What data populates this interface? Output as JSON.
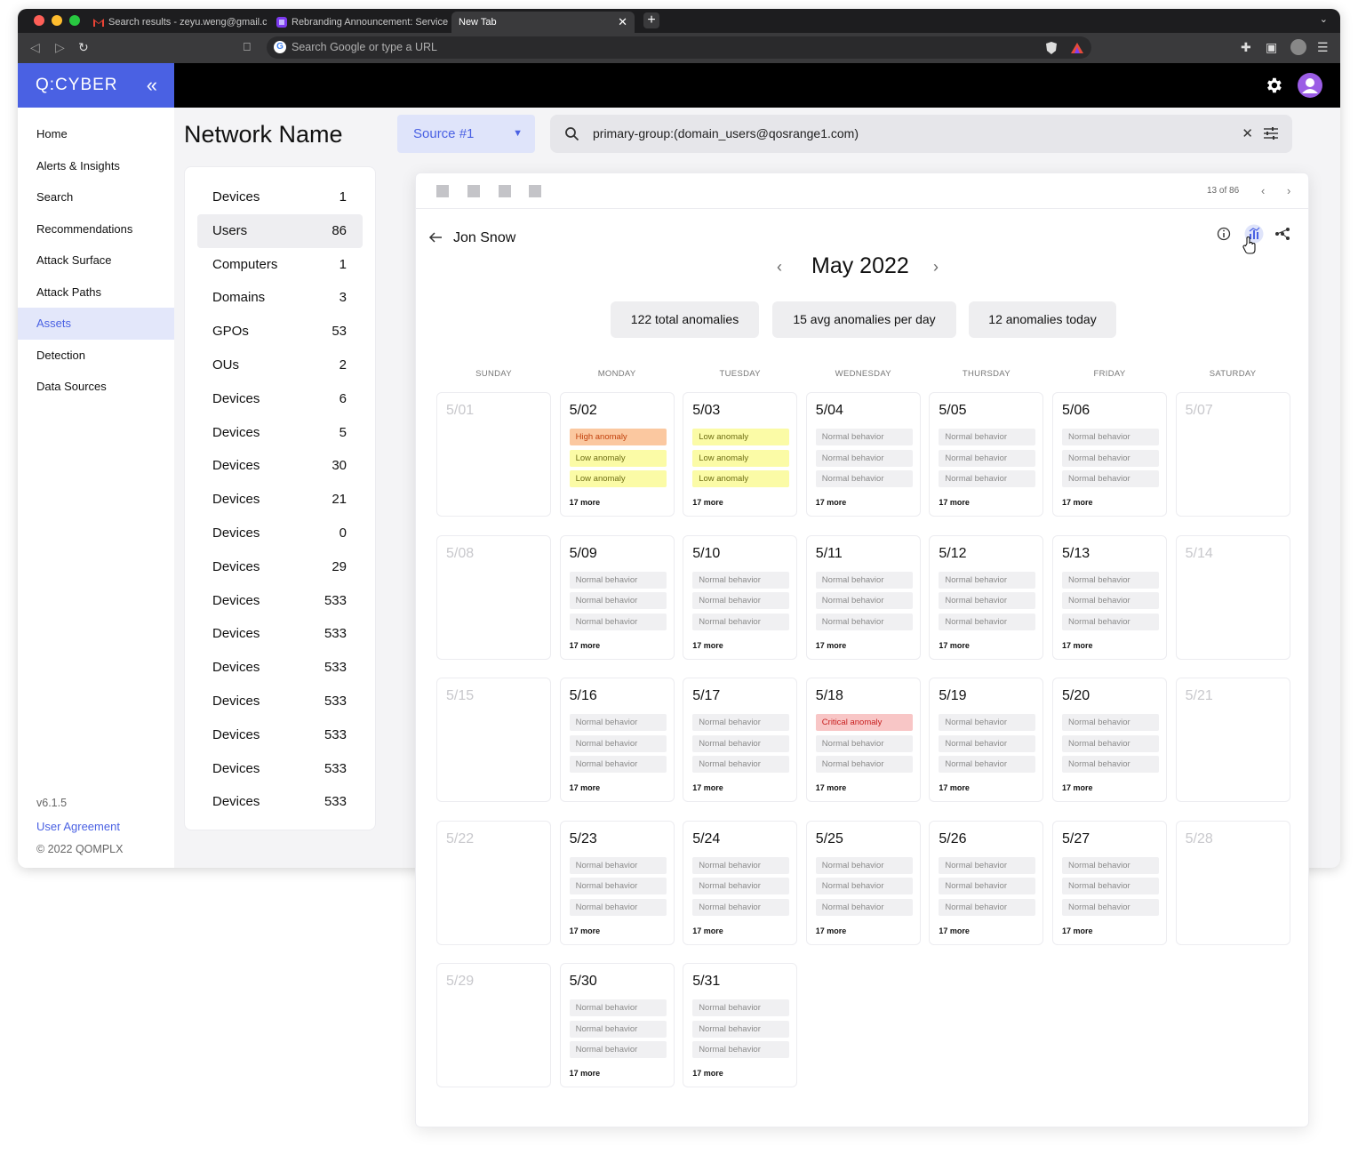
{
  "browser": {
    "tabs": [
      {
        "label": "Search results - zeyu.weng@gmail.c",
        "icon": "gmail-icon"
      },
      {
        "label": "Rebranding Announcement: Service",
        "icon": "slack-icon"
      },
      {
        "label": "New Tab",
        "active": true
      }
    ],
    "omnibox_placeholder": "Search Google or type a URL"
  },
  "app": {
    "brand": "Q:CYBER",
    "collapse_icon": "«"
  },
  "sidebar": {
    "items": [
      "Home",
      "Alerts & Insights",
      "Search",
      "Recommendations",
      "Attack Surface",
      "Attack Paths",
      "Assets",
      "Detection",
      "Data Sources"
    ],
    "active_index": 6,
    "version": "v6.1.5",
    "agreement": "User Agreement",
    "copyright": "© 2022 QOMPLX"
  },
  "network": {
    "title": "Network Name",
    "rows": [
      {
        "label": "Devices",
        "count": "1"
      },
      {
        "label": "Users",
        "count": "86",
        "selected": true
      },
      {
        "label": "Computers",
        "count": "1"
      },
      {
        "label": "Domains",
        "count": "3"
      },
      {
        "label": "GPOs",
        "count": "53"
      },
      {
        "label": "OUs",
        "count": "2"
      },
      {
        "label": "Devices",
        "count": "6"
      },
      {
        "label": "Devices",
        "count": "5"
      },
      {
        "label": "Devices",
        "count": "30"
      },
      {
        "label": "Devices",
        "count": "21"
      },
      {
        "label": "Devices",
        "count": "0"
      },
      {
        "label": "Devices",
        "count": "29"
      },
      {
        "label": "Devices",
        "count": "533"
      },
      {
        "label": "Devices",
        "count": "533"
      },
      {
        "label": "Devices",
        "count": "533"
      },
      {
        "label": "Devices",
        "count": "533"
      },
      {
        "label": "Devices",
        "count": "533"
      },
      {
        "label": "Devices",
        "count": "533"
      },
      {
        "label": "Devices",
        "count": "533"
      }
    ]
  },
  "filters": {
    "source": "Source #1",
    "query": "primary-group:(domain_users@qosrange1.com)"
  },
  "panel": {
    "pager": "13 of 86",
    "user": "Jon Snow",
    "month": "May 2022",
    "stats": [
      "122 total anomalies",
      "15 avg anomalies per day",
      "12 anomalies today"
    ],
    "weekdays": [
      "SUNDAY",
      "MONDAY",
      "TUESDAY",
      "WEDNESDAY",
      "THURSDAY",
      "FRIDAY",
      "SATURDAY"
    ],
    "more_label": "17 more",
    "statuses": {
      "normal": "Normal behavior",
      "low": "Low anomaly",
      "high": "High anomaly",
      "critical": "Critical anomaly"
    },
    "colors": {
      "normal_bg": "#f0f0f2",
      "normal_fg": "#8a8a8a",
      "low_bg": "#fbfba6",
      "low_fg": "#6f6f14",
      "high_bg": "#fbc8a0",
      "high_fg": "#c2410c",
      "critical_bg": "#f8c6c6",
      "critical_fg": "#c81e1e"
    },
    "days": [
      {
        "label": "5/01",
        "muted": true
      },
      {
        "label": "5/02",
        "tags": [
          "high",
          "low",
          "low"
        ]
      },
      {
        "label": "5/03",
        "tags": [
          "low",
          "low",
          "low"
        ]
      },
      {
        "label": "5/04",
        "tags": [
          "normal",
          "normal",
          "normal"
        ]
      },
      {
        "label": "5/05",
        "tags": [
          "normal",
          "normal",
          "normal"
        ]
      },
      {
        "label": "5/06",
        "tags": [
          "normal",
          "normal",
          "normal"
        ]
      },
      {
        "label": "5/07",
        "muted": true
      },
      {
        "label": "5/08",
        "muted": true
      },
      {
        "label": "5/09",
        "tags": [
          "normal",
          "normal",
          "normal"
        ]
      },
      {
        "label": "5/10",
        "tags": [
          "normal",
          "normal",
          "normal"
        ]
      },
      {
        "label": "5/11",
        "tags": [
          "normal",
          "normal",
          "normal"
        ]
      },
      {
        "label": "5/12",
        "tags": [
          "normal",
          "normal",
          "normal"
        ]
      },
      {
        "label": "5/13",
        "tags": [
          "normal",
          "normal",
          "normal"
        ]
      },
      {
        "label": "5/14",
        "muted": true
      },
      {
        "label": "5/15",
        "muted": true
      },
      {
        "label": "5/16",
        "tags": [
          "normal",
          "normal",
          "normal"
        ]
      },
      {
        "label": "5/17",
        "tags": [
          "normal",
          "normal",
          "normal"
        ]
      },
      {
        "label": "5/18",
        "tags": [
          "critical",
          "normal",
          "normal"
        ]
      },
      {
        "label": "5/19",
        "tags": [
          "normal",
          "normal",
          "normal"
        ]
      },
      {
        "label": "5/20",
        "tags": [
          "normal",
          "normal",
          "normal"
        ]
      },
      {
        "label": "5/21",
        "muted": true
      },
      {
        "label": "5/22",
        "muted": true
      },
      {
        "label": "5/23",
        "tags": [
          "normal",
          "normal",
          "normal"
        ]
      },
      {
        "label": "5/24",
        "tags": [
          "normal",
          "normal",
          "normal"
        ]
      },
      {
        "label": "5/25",
        "tags": [
          "normal",
          "normal",
          "normal"
        ]
      },
      {
        "label": "5/26",
        "tags": [
          "normal",
          "normal",
          "normal"
        ]
      },
      {
        "label": "5/27",
        "tags": [
          "normal",
          "normal",
          "normal"
        ]
      },
      {
        "label": "5/28",
        "muted": true
      },
      {
        "label": "5/29",
        "muted": true
      },
      {
        "label": "5/30",
        "tags": [
          "normal",
          "normal",
          "normal"
        ]
      },
      {
        "label": "5/31",
        "tags": [
          "normal",
          "normal",
          "normal"
        ]
      }
    ]
  }
}
